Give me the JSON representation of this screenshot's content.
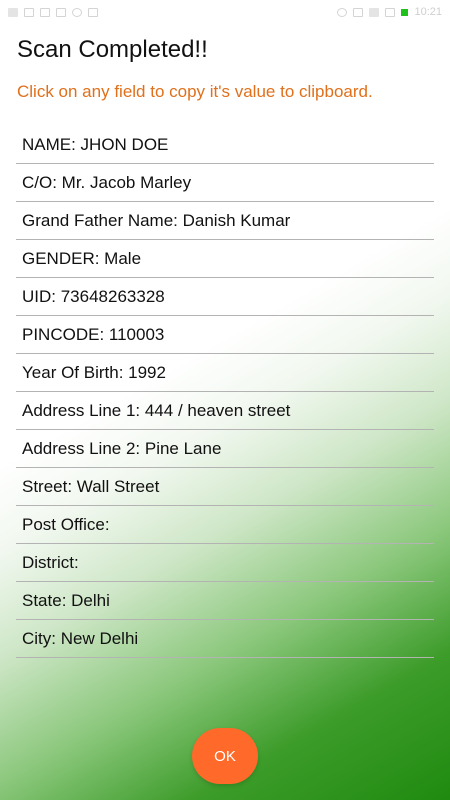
{
  "status_bar": {
    "time": "10:21"
  },
  "header": {
    "title": "Scan Completed!!",
    "subtitle": "Click on any field to copy it's value to clipboard."
  },
  "fields": [
    {
      "label": "NAME: JHON DOE"
    },
    {
      "label": "C/O: Mr. Jacob Marley"
    },
    {
      "label": "Grand Father Name: Danish Kumar"
    },
    {
      "label": "GENDER: Male"
    },
    {
      "label": "UID: 73648263328"
    },
    {
      "label": "PINCODE: 110003"
    },
    {
      "label": "Year Of Birth: 1992"
    },
    {
      "label": "Address Line 1: 444 / heaven street"
    },
    {
      "label": "Address Line 2: Pine Lane"
    },
    {
      "label": "Street: Wall Street"
    },
    {
      "label": "Post Office:"
    },
    {
      "label": "District:"
    },
    {
      "label": "State: Delhi"
    },
    {
      "label": "City: New Delhi"
    }
  ],
  "actions": {
    "ok_label": "OK"
  },
  "colors": {
    "accent_orange": "#e0701b",
    "button_orange": "#ff6a2b",
    "gradient_green": "#1f8a0f"
  }
}
